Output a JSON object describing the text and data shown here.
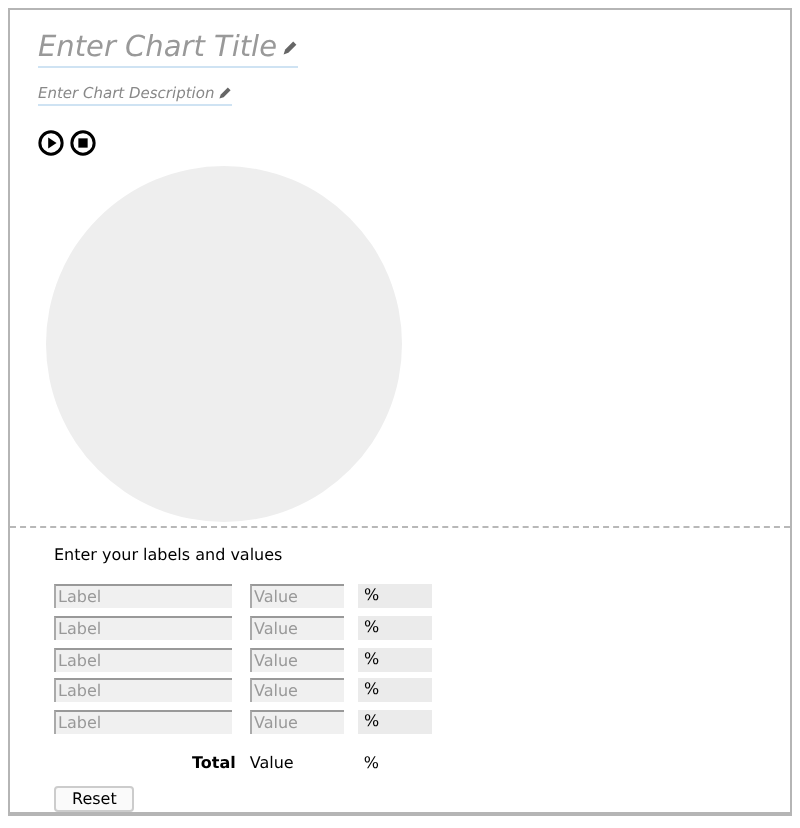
{
  "chart": {
    "title_placeholder": "Enter Chart Title",
    "description_placeholder": "Enter Chart Description"
  },
  "entry": {
    "heading": "Enter your labels and values",
    "rows": [
      {
        "label": {
          "placeholder": "Label"
        },
        "value": {
          "placeholder": "Value"
        },
        "percent": "%"
      },
      {
        "label": {
          "placeholder": "Label"
        },
        "value": {
          "placeholder": "Value"
        },
        "percent": "%"
      },
      {
        "label": {
          "placeholder": "Label"
        },
        "value": {
          "placeholder": "Value"
        },
        "percent": "%"
      },
      {
        "label": {
          "placeholder": "Label"
        },
        "value": {
          "placeholder": "Value"
        },
        "percent": "%"
      },
      {
        "label": {
          "placeholder": "Label"
        },
        "value": {
          "placeholder": "Value"
        },
        "percent": "%"
      }
    ],
    "total": {
      "label": "Total",
      "value": "Value",
      "percent": "%"
    },
    "reset_button": "Reset"
  }
}
